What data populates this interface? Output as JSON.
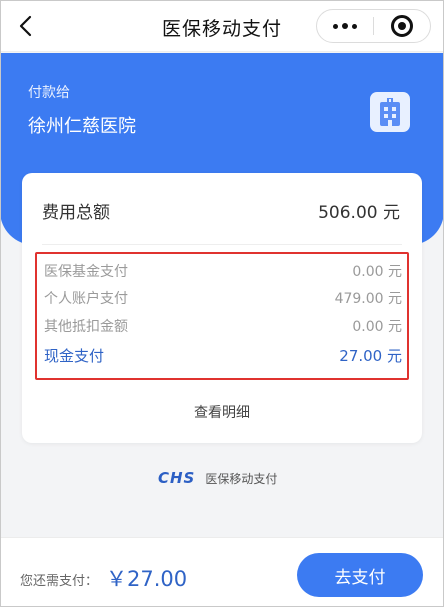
{
  "navbar": {
    "title": "医保移动支付",
    "back_icon": "chevron-left-icon",
    "more_icon": "more-dots-icon",
    "close_icon": "target-close-icon"
  },
  "header": {
    "pay_to_label": "付款给",
    "hospital_name": "徐州仁慈医院",
    "hospital_icon": "hospital-building-icon",
    "accent_color": "#3c7bf2"
  },
  "card": {
    "total_label": "费用总额",
    "total_value": "506.00 元",
    "breakdown": [
      {
        "label": "医保基金支付",
        "value": "0.00 元"
      },
      {
        "label": "个人账户支付",
        "value": "479.00 元"
      },
      {
        "label": "其他抵扣金额",
        "value": "0.00 元"
      },
      {
        "label": "现金支付",
        "value": "27.00 元"
      }
    ],
    "detail_link": "查看明细",
    "highlight_color": "#e0322f"
  },
  "brand": {
    "logo": "CHS",
    "text": "医保移动支付"
  },
  "bottom": {
    "need_pay_label": "您还需支付：",
    "need_pay_value": "￥27.00",
    "pay_button": "去支付"
  }
}
